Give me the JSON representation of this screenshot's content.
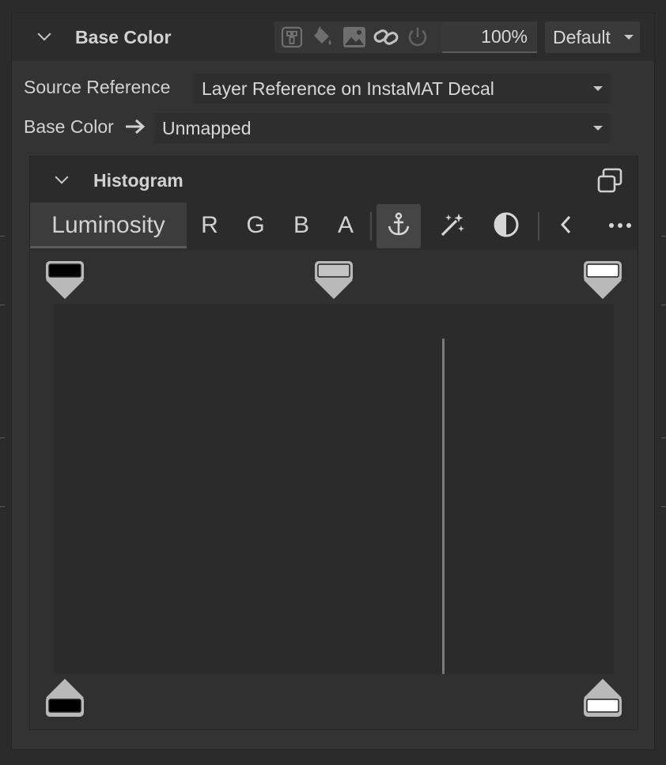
{
  "panel": {
    "title": "Base Color",
    "header_icons": [
      "material-layer-icon",
      "paint-bucket-icon",
      "image-icon",
      "link-icon",
      "power-icon"
    ],
    "opacity": "100%",
    "blend_mode": "Default"
  },
  "fields": [
    {
      "label": "Source Reference",
      "value": "Layer Reference on InstaMAT Decal"
    },
    {
      "label": "Base Color",
      "value": "Unmapped"
    }
  ],
  "histogram": {
    "title": "Histogram",
    "tabs": [
      "Luminosity",
      "R",
      "G",
      "B",
      "A"
    ],
    "active_tab": "Luminosity",
    "tools": [
      "anchor-icon",
      "magic-wand-icon",
      "contrast-icon",
      "chevron-left-icon",
      "more-icon"
    ],
    "input_levels": {
      "black": 0.0,
      "gray": 0.5,
      "white": 1.0
    },
    "output_levels": {
      "black": 0.0,
      "white": 1.0
    },
    "spike_position": 0.694,
    "colors": {
      "black": "#000000",
      "gray": "#c4c4c4",
      "white": "#ffffff",
      "marker": "#b9b9b9"
    }
  }
}
